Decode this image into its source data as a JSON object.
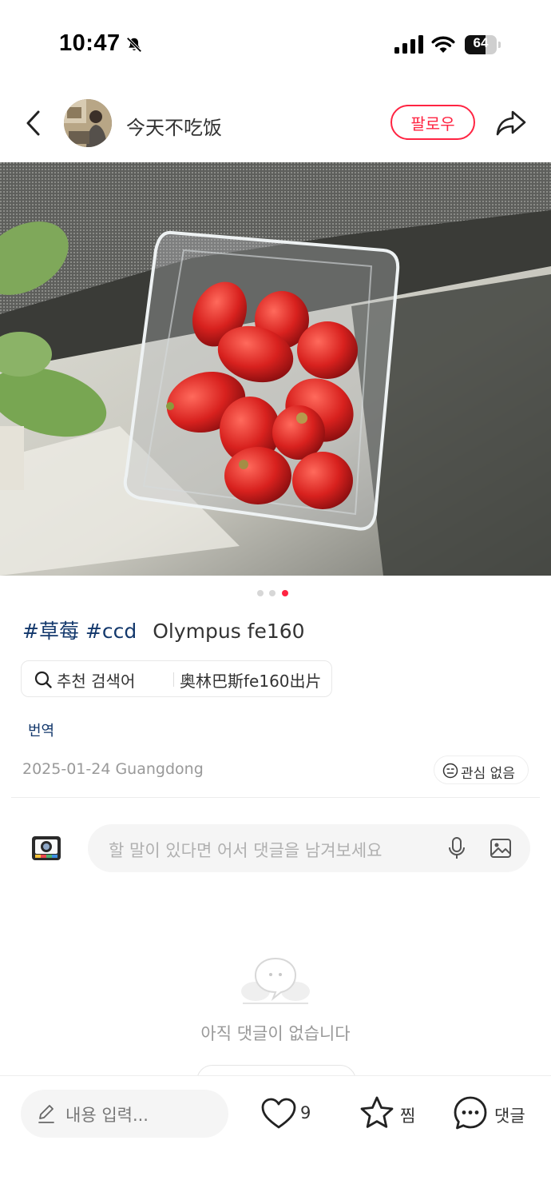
{
  "status_bar": {
    "time": "10:47",
    "battery": "64",
    "battery_level": 0.64,
    "icons": [
      "bell-off-icon",
      "signal-icon",
      "wifi-icon",
      "battery-icon"
    ]
  },
  "header": {
    "username": "今天不吃饭",
    "follow_label": "팔로우",
    "icons": [
      "chevron-left-icon",
      "share-icon"
    ]
  },
  "carousel": {
    "total": 3,
    "active": 3
  },
  "post": {
    "tags": [
      "#草莓",
      "#ccd"
    ],
    "text": "Olympus fe160",
    "search_label": "추천 검색어",
    "search_term": "奥林巴斯fe160出片",
    "translate_label": "번역",
    "date_location": "2025-01-24 Guangdong",
    "not_interested_label": "관심 없음"
  },
  "comments": {
    "placeholder": "할 말이 있다면 어서 댓글을 남겨보세요",
    "empty_text": "아직 댓글이 없습니다"
  },
  "bottom_bar": {
    "input_placeholder": "내용 입력...",
    "like_count": "9",
    "save_label": "찜",
    "comment_label": "댓글"
  },
  "colors": {
    "brand": "#ff2442",
    "tag": "#13386c",
    "muted": "#999999"
  }
}
